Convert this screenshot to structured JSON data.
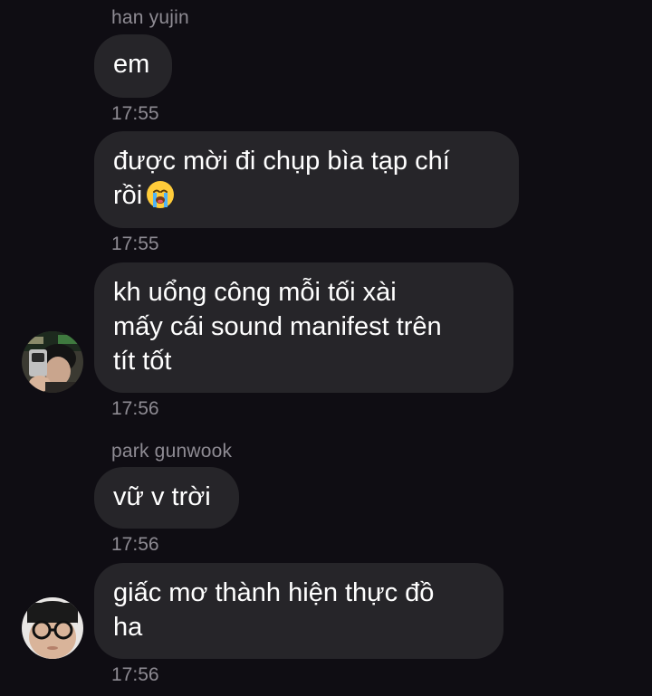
{
  "messages": [
    {
      "sender": "han yujin",
      "text_lines": [
        "em"
      ],
      "time": "17:55"
    },
    {
      "text_lines": [
        "được mời đi chụp bìa tạp chí",
        "rồi"
      ],
      "emoji": "loudly-crying-face",
      "time": "17:55"
    },
    {
      "text_lines": [
        "kh uổng công mỗi tối xài",
        "mấy cái sound manifest trên",
        "tít tốt"
      ],
      "time": "17:56"
    },
    {
      "sender": "park gunwook",
      "text_lines": [
        "vữ v trời"
      ],
      "time": "17:56"
    },
    {
      "text_lines": [
        "giấc mơ thành hiện thực đồ",
        "ha"
      ],
      "time": "17:56"
    }
  ],
  "avatars": [
    {
      "icon": "user-photo-avatar-hanyujin"
    },
    {
      "icon": "user-photo-avatar-parkgunwook"
    }
  ],
  "colors": {
    "background": "#0f0d13",
    "bubble": "#262529",
    "meta_text": "#8e8b93",
    "message_text": "#ffffff"
  }
}
